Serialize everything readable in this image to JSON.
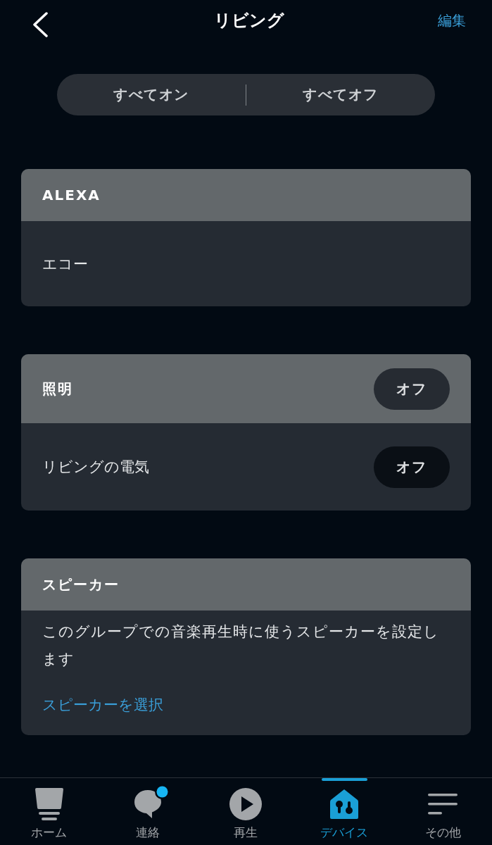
{
  "header": {
    "title": "リビング",
    "edit_button": "編集"
  },
  "bulk_actions": [
    "すべてオン",
    "すべてオフ"
  ],
  "sections": [
    {
      "kind": "devices",
      "title": "ALEXA",
      "items": [
        {
          "name": "エコー"
        }
      ]
    },
    {
      "kind": "devices",
      "title": "照明",
      "action": "オフ",
      "items": [
        {
          "name": "リビングの電気",
          "action": "オフ"
        }
      ]
    },
    {
      "kind": "info",
      "title": "スピーカー",
      "description": "このグループでの音楽再生時に使うスピーカーを設定します",
      "link": "スピーカーを選択"
    }
  ],
  "tab_bar": {
    "tabs": [
      {
        "label": "ホーム",
        "selected": false,
        "notification": false
      },
      {
        "label": "連絡",
        "selected": false,
        "notification": true
      },
      {
        "label": "再生",
        "selected": false,
        "notification": false
      },
      {
        "label": "デバイス",
        "selected": true,
        "notification": false
      },
      {
        "label": "その他",
        "selected": false,
        "notification": false
      }
    ]
  }
}
